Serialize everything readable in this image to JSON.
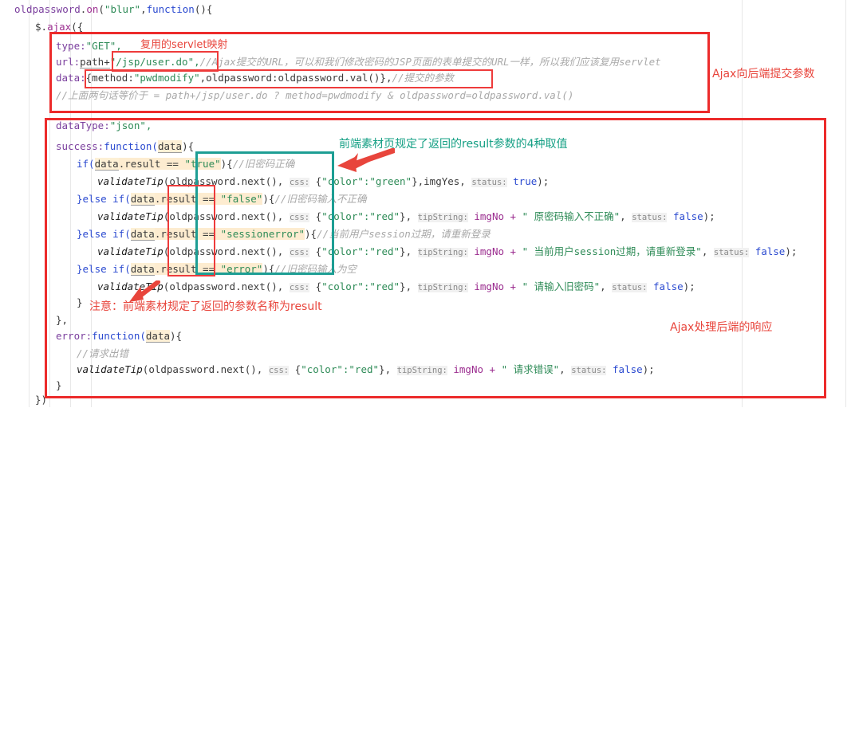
{
  "editor": {
    "language": "javascript",
    "background": "#ffffff"
  },
  "colors": {
    "annotation_red": "#ec2b2b",
    "annotation_teal": "#1d9e94",
    "string_green": "#2e8b57",
    "keyword_purple": "#7a3e9d",
    "comment_grey": "#a9a9a9",
    "literal_blue": "#2b4ad0",
    "variable_magenta": "#9b2d8f",
    "highlight_yellow": "#fdf0d5"
  },
  "code_lines": {
    "l01": "oldpassword.on(\"blur\",function(){",
    "l02": "$.ajax({",
    "l03_a": "type:",
    "l03_b": "\"GET\",",
    "l04_a": "url:",
    "l04_b": "path+",
    "l04_c": "\"/jsp/user.do\",",
    "l04_cmt": "//Ajax提交的URL，可以和我们修改密码的JSP页面的表单提交的URL一样，所以我们应该复用servlet",
    "l05_a": "data:",
    "l05_b": "{method:",
    "l05_c": "\"pwdmodify\"",
    "l05_d": ",oldpassword:oldpassword.val()},",
    "l05_cmt": "//提交的参数",
    "l06_cmt": "//上面两句话等价于 = path+/jsp/user.do ? method=pwdmodify & oldpassword=oldpassword.val()",
    "l07_a": "dataType:",
    "l07_b": "\"json\",",
    "l08_a": "success:",
    "l08_b": "function(",
    "l08_c": "data",
    "l08_d": "){",
    "l09_a": "if(",
    "l09_b": "data",
    "l09_c": ".result == ",
    "l09_d": "\"true\"",
    "l09_e": "){",
    "l09_cmt": "//旧密码正确",
    "l10_fn": "validateTip",
    "l10_a": "(oldpassword.next(), ",
    "l10_css": "css:",
    "l10_b": " {",
    "l10_c": "\"color\":\"green\"",
    "l10_d": "},imgYes, ",
    "l10_status": "status:",
    "l10_e": " ",
    "l10_f": "true",
    "l10_g": ");",
    "l11_a": "}else if(",
    "l11_b": "data",
    "l11_c": ".result == ",
    "l11_d": "\"false\"",
    "l11_e": "){",
    "l11_cmt": "//旧密码输入不正确",
    "l12_fn": "validateTip",
    "l12_a": "(oldpassword.next(), ",
    "l12_css": "css:",
    "l12_b": " {",
    "l12_c": "\"color\":\"red\"",
    "l12_d": "}, ",
    "l12_tip": "tipString:",
    "l12_e": " imgNo + ",
    "l12_f": "\" 原密码输入不正确\"",
    "l12_g": ", ",
    "l12_status": "status:",
    "l12_h": " ",
    "l12_i": "false",
    "l12_j": ");",
    "l13_a": "}else if(",
    "l13_b": "data",
    "l13_c": ".result == ",
    "l13_d": "\"sessionerror\"",
    "l13_e": "){",
    "l13_cmt": "//当前用户session过期，请重新登录",
    "l14_fn": "validateTip",
    "l14_a": "(oldpassword.next(), ",
    "l14_css": "css:",
    "l14_b": " {",
    "l14_c": "\"color\":\"red\"",
    "l14_d": "}, ",
    "l14_tip": "tipString:",
    "l14_e": " imgNo + ",
    "l14_f": "\" 当前用户session过期，请重新登录\"",
    "l14_g": ", ",
    "l14_status": "status:",
    "l14_h": " ",
    "l14_i": "false",
    "l14_j": ");",
    "l15_a": "}else if(",
    "l15_b": "data",
    "l15_c": ".result == ",
    "l15_d": "\"error\"",
    "l15_e": "){",
    "l15_cmt": "//旧密码输入为空",
    "l16_fn": "validateTip",
    "l16_a": "(oldpassword.next(), ",
    "l16_css": "css:",
    "l16_b": " {",
    "l16_c": "\"color\":\"red\"",
    "l16_d": "}, ",
    "l16_tip": "tipString:",
    "l16_e": " imgNo + ",
    "l16_f": "\" 请输入旧密码\"",
    "l16_g": ", ",
    "l16_status": "status:",
    "l16_h": " ",
    "l16_i": "false",
    "l16_j": ");",
    "l17": "}",
    "l18": "},",
    "l19_a": "error:",
    "l19_b": "function(",
    "l19_c": "data",
    "l19_d": "){",
    "l20_cmt": "//请求出错",
    "l21_fn": "validateTip",
    "l21_a": "(oldpassword.next(), ",
    "l21_css": "css:",
    "l21_b": " {",
    "l21_c": "\"color\":\"red\"",
    "l21_d": "}, ",
    "l21_tip": "tipString:",
    "l21_e": " imgNo + ",
    "l21_f": "\" 请求错误\"",
    "l21_g": ", ",
    "l21_status": "status:",
    "l21_h": " ",
    "l21_i": "false",
    "l21_j": ");",
    "l22": "}",
    "l23": "})"
  },
  "annotations": {
    "servlet_reuse": "复用的servlet映射",
    "submit_params": "Ajax向后端提交参数",
    "result_values": "前端素材页规定了返回的result参数的4种取值",
    "param_name_note": "注意：前端素材规定了返回的参数名称为result",
    "handle_response": "Ajax处理后端的响应"
  }
}
